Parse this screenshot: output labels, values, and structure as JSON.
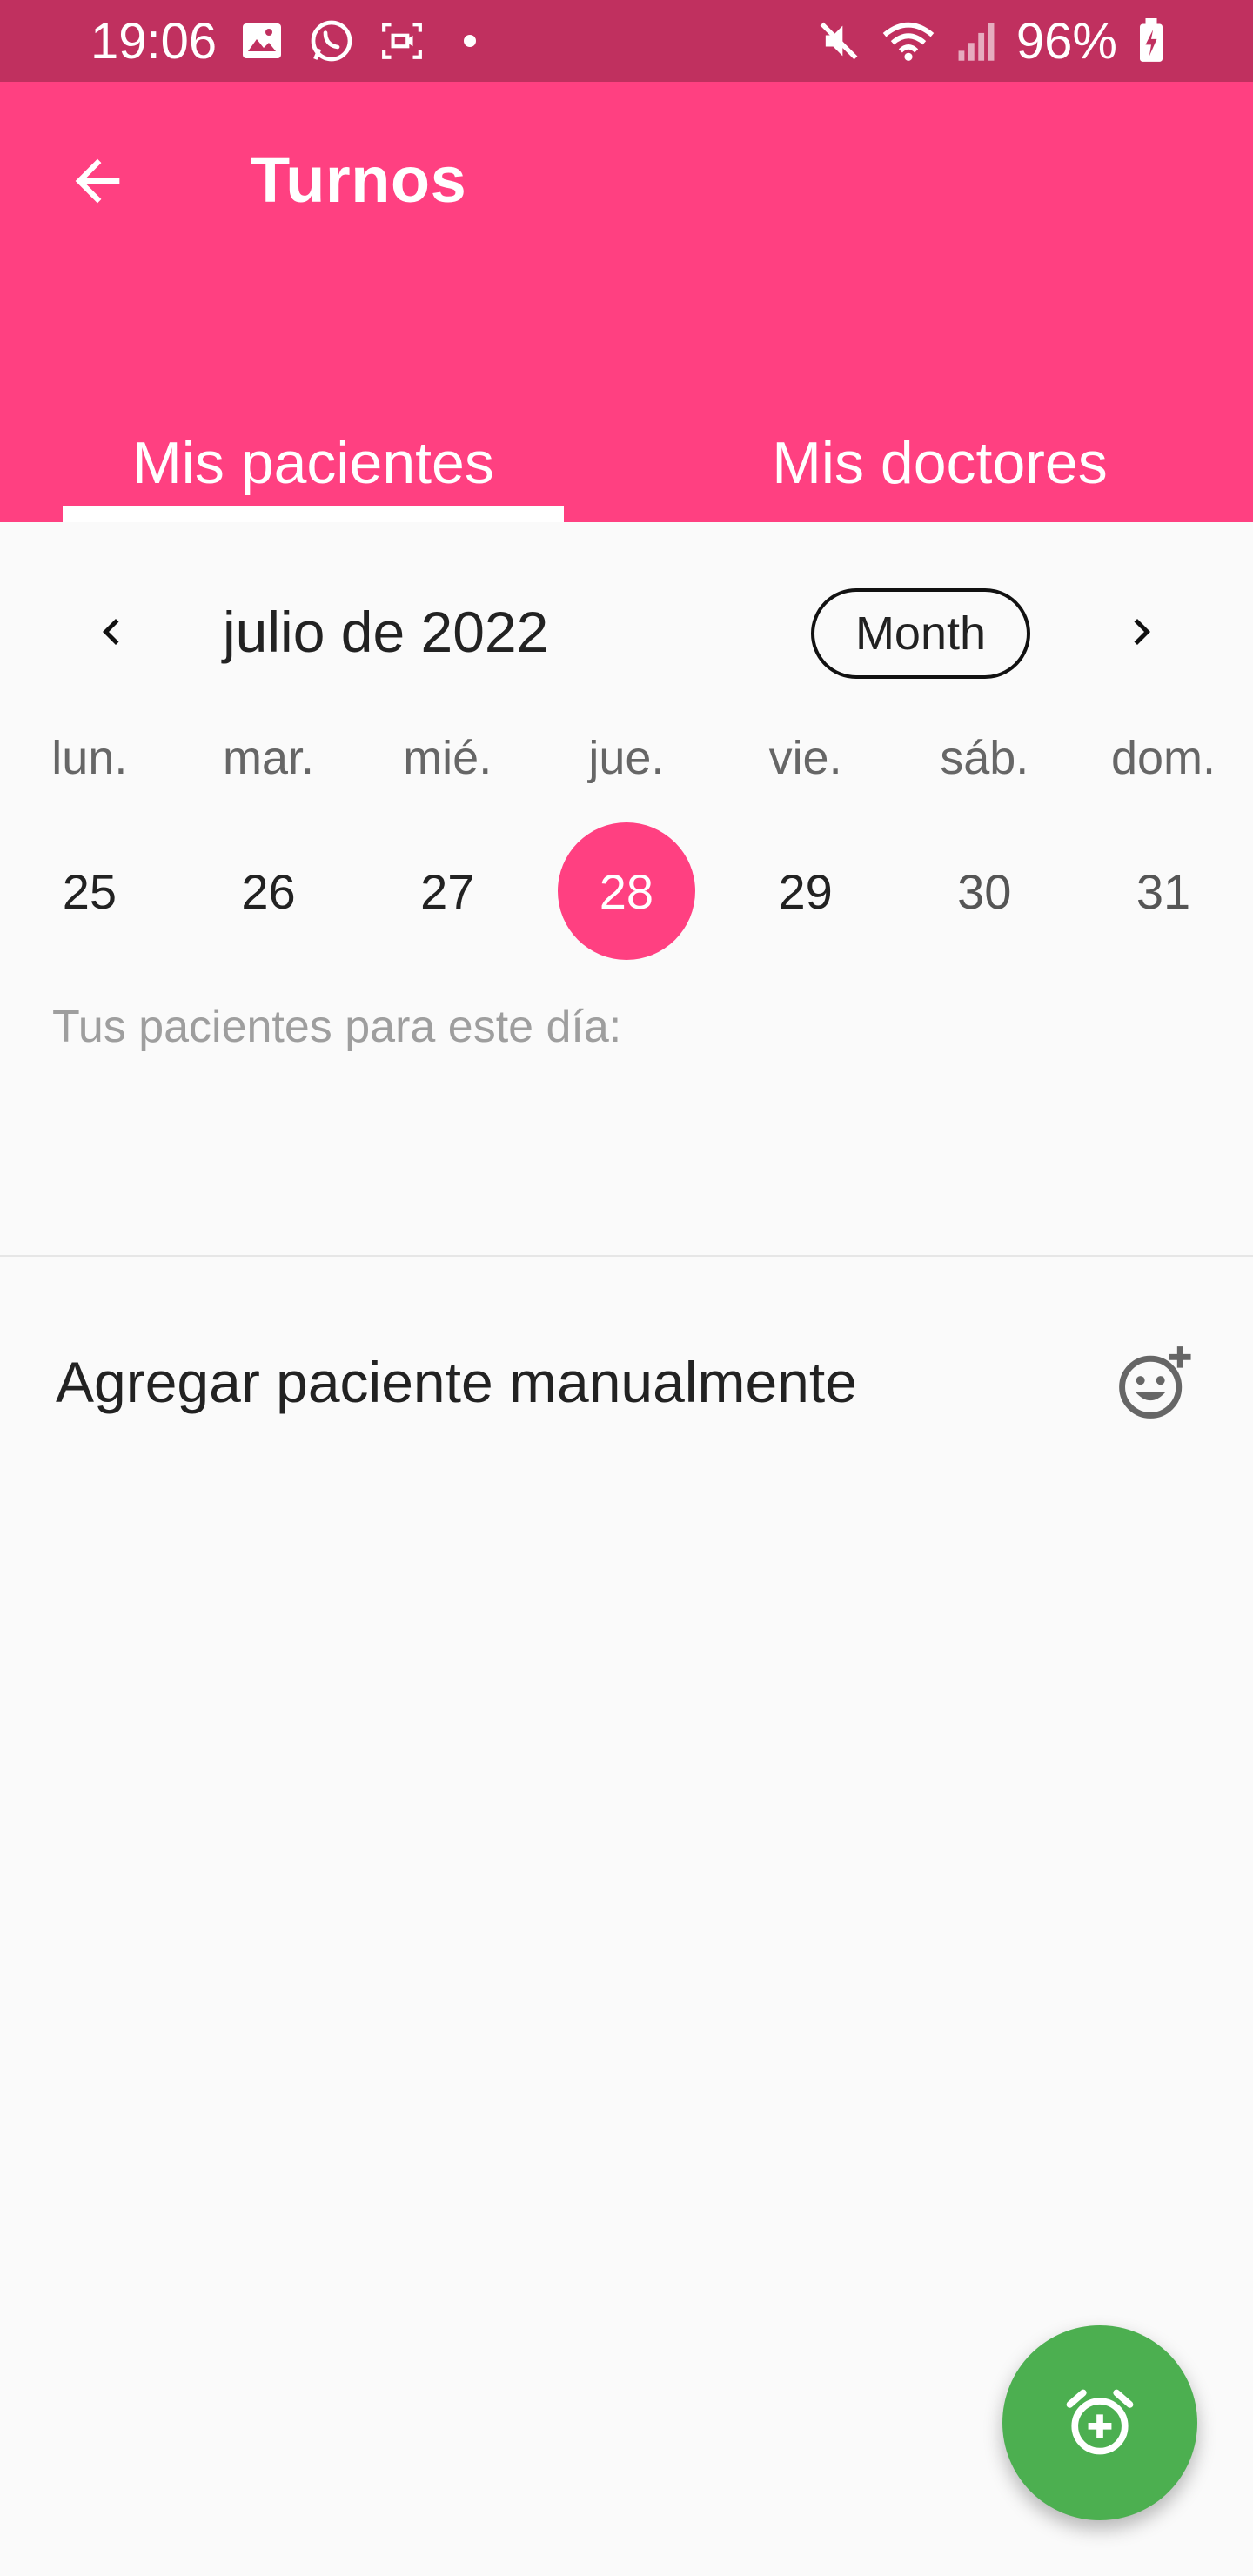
{
  "status_bar": {
    "time": "19:06",
    "battery": "96%",
    "icons": [
      "image-icon",
      "whatsapp-icon",
      "screen-record-icon",
      "mute-icon",
      "wifi-icon",
      "signal-icon",
      "battery-charging-icon"
    ]
  },
  "app_bar": {
    "title": "Turnos",
    "back_icon": "arrow-back-icon",
    "color": "#ff4081"
  },
  "tabs": [
    {
      "label": "Mis pacientes",
      "selected": true
    },
    {
      "label": "Mis doctores",
      "selected": false
    }
  ],
  "calendar": {
    "month_label": "julio de 2022",
    "format_button": "Month",
    "weekdays": [
      "lun.",
      "mar.",
      "mié.",
      "jue.",
      "vie.",
      "sáb.",
      "dom."
    ],
    "days": [
      "25",
      "26",
      "27",
      "28",
      "29",
      "30",
      "31"
    ],
    "selected_day": "28",
    "selected_color": "#ff4081"
  },
  "patients_label": "Tus pacientes para este día:",
  "add_patient": {
    "label": "Agregar paciente manualmente",
    "icon": "add-reaction-icon"
  },
  "fab": {
    "icon": "add-alarm-icon",
    "color": "#4caf50"
  }
}
